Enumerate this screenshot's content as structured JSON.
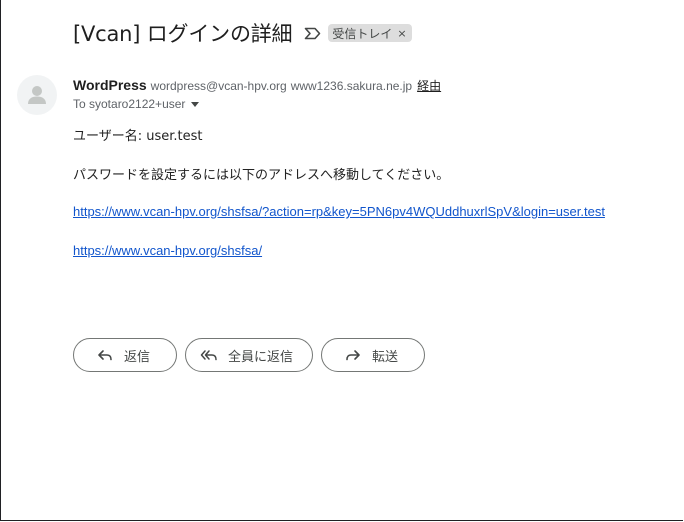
{
  "email": {
    "subject": "[Vcan] ログインの詳細",
    "label": "受信トレイ",
    "label_remove": "×",
    "sender": {
      "name": "WordPress",
      "email": "wordpress@vcan-hpv.org",
      "via_host": "www1236.sakura.ne.jp",
      "via_label": "経由"
    },
    "to": "To syotaro2122+user",
    "body": {
      "username_line": "ユーザー名: user.test",
      "instruction": "パスワードを設定するには以下のアドレスへ移動してください。",
      "reset_link": "https://www.vcan-hpv.org/shsfsa/?action=rp&key=5PN6pv4WQUddhuxrlSpV&login=user.test",
      "site_link": "https://www.vcan-hpv.org/shsfsa/"
    }
  },
  "actions": {
    "reply": "返信",
    "reply_all": "全員に返信",
    "forward": "転送"
  },
  "icons": {
    "important": "important-marker-icon",
    "avatar": "person-icon",
    "reply": "reply-arrow-icon",
    "reply_all": "reply-all-arrow-icon",
    "forward": "forward-arrow-icon"
  },
  "colors": {
    "link": "#1155cc",
    "chip_bg": "#dddddd",
    "button_border": "#747775"
  }
}
